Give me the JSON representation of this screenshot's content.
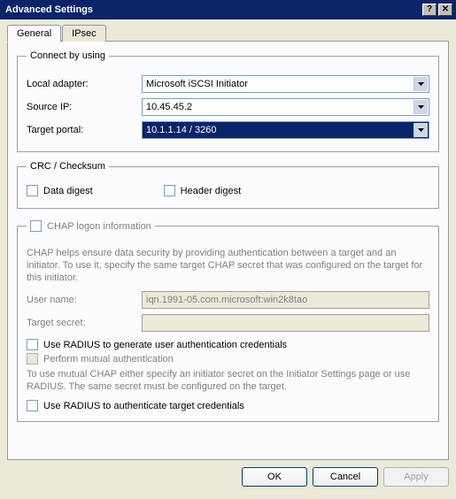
{
  "window": {
    "title": "Advanced Settings"
  },
  "tabs": {
    "general": "General",
    "ipsec": "IPsec"
  },
  "connect": {
    "legend": "Connect by using",
    "local_adapter_label": "Local adapter:",
    "local_adapter_value": "Microsoft iSCSI Initiator",
    "source_ip_label": "Source IP:",
    "source_ip_value": "10.45.45.2",
    "target_portal_label": "Target portal:",
    "target_portal_value": "10.1.1.14 / 3260"
  },
  "crc": {
    "legend": "CRC / Checksum",
    "data_digest": "Data digest",
    "header_digest": "Header digest"
  },
  "chap": {
    "legend": "CHAP logon information",
    "help": "CHAP helps ensure data security by providing authentication between a target and an initiator. To use it, specify the same target CHAP secret that was configured on the target for this initiator.",
    "user_name_label": "User name:",
    "user_name_value": "iqn.1991-05.com.microsoft:win2k8tao",
    "target_secret_label": "Target secret:",
    "radius_generate": "Use RADIUS to generate user authentication credentials",
    "mutual": "Perform mutual authentication",
    "mutual_help": "To use mutual CHAP either specify an initiator secret on the Initiator Settings page or use RADIUS.  The same secret must be configured on the target.",
    "radius_auth": "Use RADIUS to authenticate target credentials"
  },
  "buttons": {
    "ok": "OK",
    "cancel": "Cancel",
    "apply": "Apply"
  }
}
